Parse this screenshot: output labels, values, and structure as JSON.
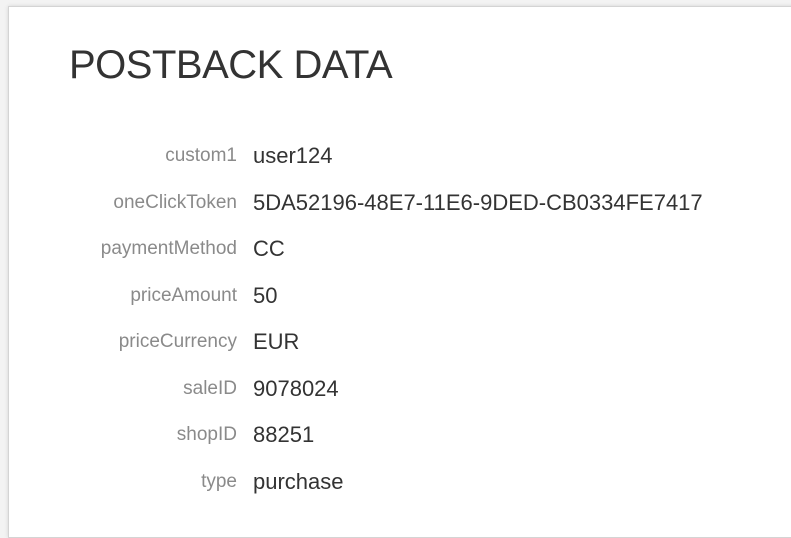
{
  "title": "POSTBACK DATA",
  "fields": [
    {
      "key": "custom1",
      "value": "user124"
    },
    {
      "key": "oneClickToken",
      "value": "5DA52196-48E7-11E6-9DED-CB0334FE7417"
    },
    {
      "key": "paymentMethod",
      "value": "CC"
    },
    {
      "key": "priceAmount",
      "value": "50"
    },
    {
      "key": "priceCurrency",
      "value": "EUR"
    },
    {
      "key": "saleID",
      "value": "9078024"
    },
    {
      "key": "shopID",
      "value": "88251"
    },
    {
      "key": "type",
      "value": "purchase"
    }
  ]
}
